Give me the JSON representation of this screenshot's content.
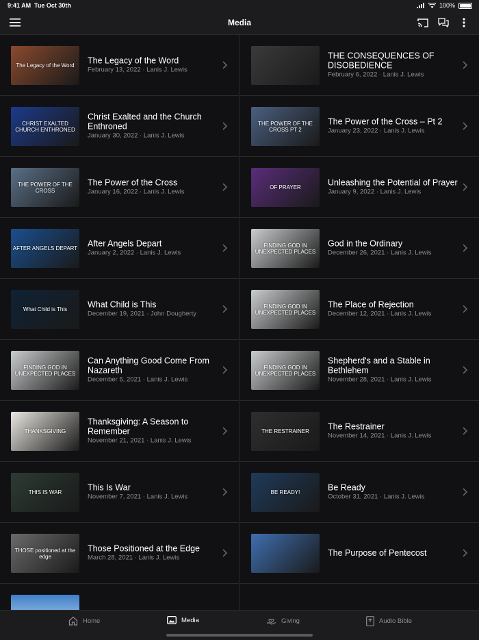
{
  "status": {
    "time": "9:41 AM",
    "date": "Tue Oct 30th",
    "battery": "100%"
  },
  "nav": {
    "title": "Media"
  },
  "items_left": [
    {
      "title": "The Legacy of the Word",
      "meta": "February 13, 2022 · Lanis J. Lewis",
      "thumb_text": "The Legacy of the Word"
    },
    {
      "title": "Christ Exalted and the Church Enthroned",
      "meta": "January 30, 2022 · Lanis J. Lewis",
      "thumb_text": "CHRIST EXALTED CHURCH ENTHRONED"
    },
    {
      "title": "The Power of the Cross",
      "meta": "January 16, 2022 · Lanis J. Lewis",
      "thumb_text": "THE POWER OF THE CROSS"
    },
    {
      "title": "After Angels Depart",
      "meta": "January 2, 2022 · Lanis J. Lewis",
      "thumb_text": "AFTER ANGELS DEPART"
    },
    {
      "title": "What Child is This",
      "meta": "December 19, 2021 · John Dougherty",
      "thumb_text": "What Child is This"
    },
    {
      "title": "Can Anything Good Come From Nazareth",
      "meta": "December 5, 2021 · Lanis J. Lewis",
      "thumb_text": "FINDING GOD IN UNEXPECTED PLACES"
    },
    {
      "title": "Thanksgiving: A Season to Remember",
      "meta": "November 21, 2021 · Lanis J. Lewis",
      "thumb_text": "THANKSGIVING"
    },
    {
      "title": "This Is War",
      "meta": "November 7, 2021 · Lanis J. Lewis",
      "thumb_text": "THIS IS WAR"
    },
    {
      "title": "Those Positioned at the Edge",
      "meta": "March 28, 2021 · Lanis J. Lewis",
      "thumb_text": "THOSE positioned at the edge"
    }
  ],
  "items_right": [
    {
      "title": "THE CONSEQUENCES OF DISOBEDIENCE",
      "meta": "February 6, 2022 · Lanis J. Lewis",
      "thumb_text": ""
    },
    {
      "title": "The Power of the Cross – Pt 2",
      "meta": "January 23, 2022 · Lanis J. Lewis",
      "thumb_text": "THE POWER OF THE CROSS PT 2"
    },
    {
      "title": "Unleashing the Potential of Prayer",
      "meta": "January 9, 2022 · Lanis J. Lewis",
      "thumb_text": "OF PRAYER"
    },
    {
      "title": "God in the Ordinary",
      "meta": "December 26, 2021 · Lanis J. Lewis",
      "thumb_text": "FINDING GOD IN UNEXPECTED PLACES"
    },
    {
      "title": "The Place of Rejection",
      "meta": "December 12, 2021 · Lanis J. Lewis",
      "thumb_text": "FINDING GOD IN UNEXPECTED PLACES"
    },
    {
      "title": "Shepherd's and a Stable in Bethlehem",
      "meta": "November 28, 2021 · Lanis J. Lewis",
      "thumb_text": "FINDING GOD IN UNEXPECTED PLACES"
    },
    {
      "title": "The Restrainer",
      "meta": "November 14, 2021 · Lanis J. Lewis",
      "thumb_text": "THE RESTRAINER"
    },
    {
      "title": "Be Ready",
      "meta": "October 31, 2021 · Lanis J. Lewis",
      "thumb_text": "BE READY!"
    },
    {
      "title": "The Purpose of Pentecost",
      "meta": "",
      "thumb_text": ""
    }
  ],
  "thumb_colors_left": [
    "#8a4a2e",
    "#1d3a8a",
    "#5a6f86",
    "#1a4f8f",
    "#0f2235",
    "#c9cccd",
    "#e9e6e0",
    "#2d3b33",
    "#6a6a6a"
  ],
  "thumb_colors_right": [
    "#3a3a3a",
    "#4a5f7f",
    "#5a2d7a",
    "#c9cccd",
    "#c9cccd",
    "#c9cccd",
    "#2e2e2e",
    "#1f3a5a",
    "#3f6fb0"
  ],
  "tabs": [
    {
      "label": "Home",
      "icon": "home-icon",
      "active": false
    },
    {
      "label": "Media",
      "icon": "media-icon",
      "active": true
    },
    {
      "label": "Giving",
      "icon": "giving-icon",
      "active": false
    },
    {
      "label": "Audio Bible",
      "icon": "audio-bible-icon",
      "active": false
    }
  ]
}
